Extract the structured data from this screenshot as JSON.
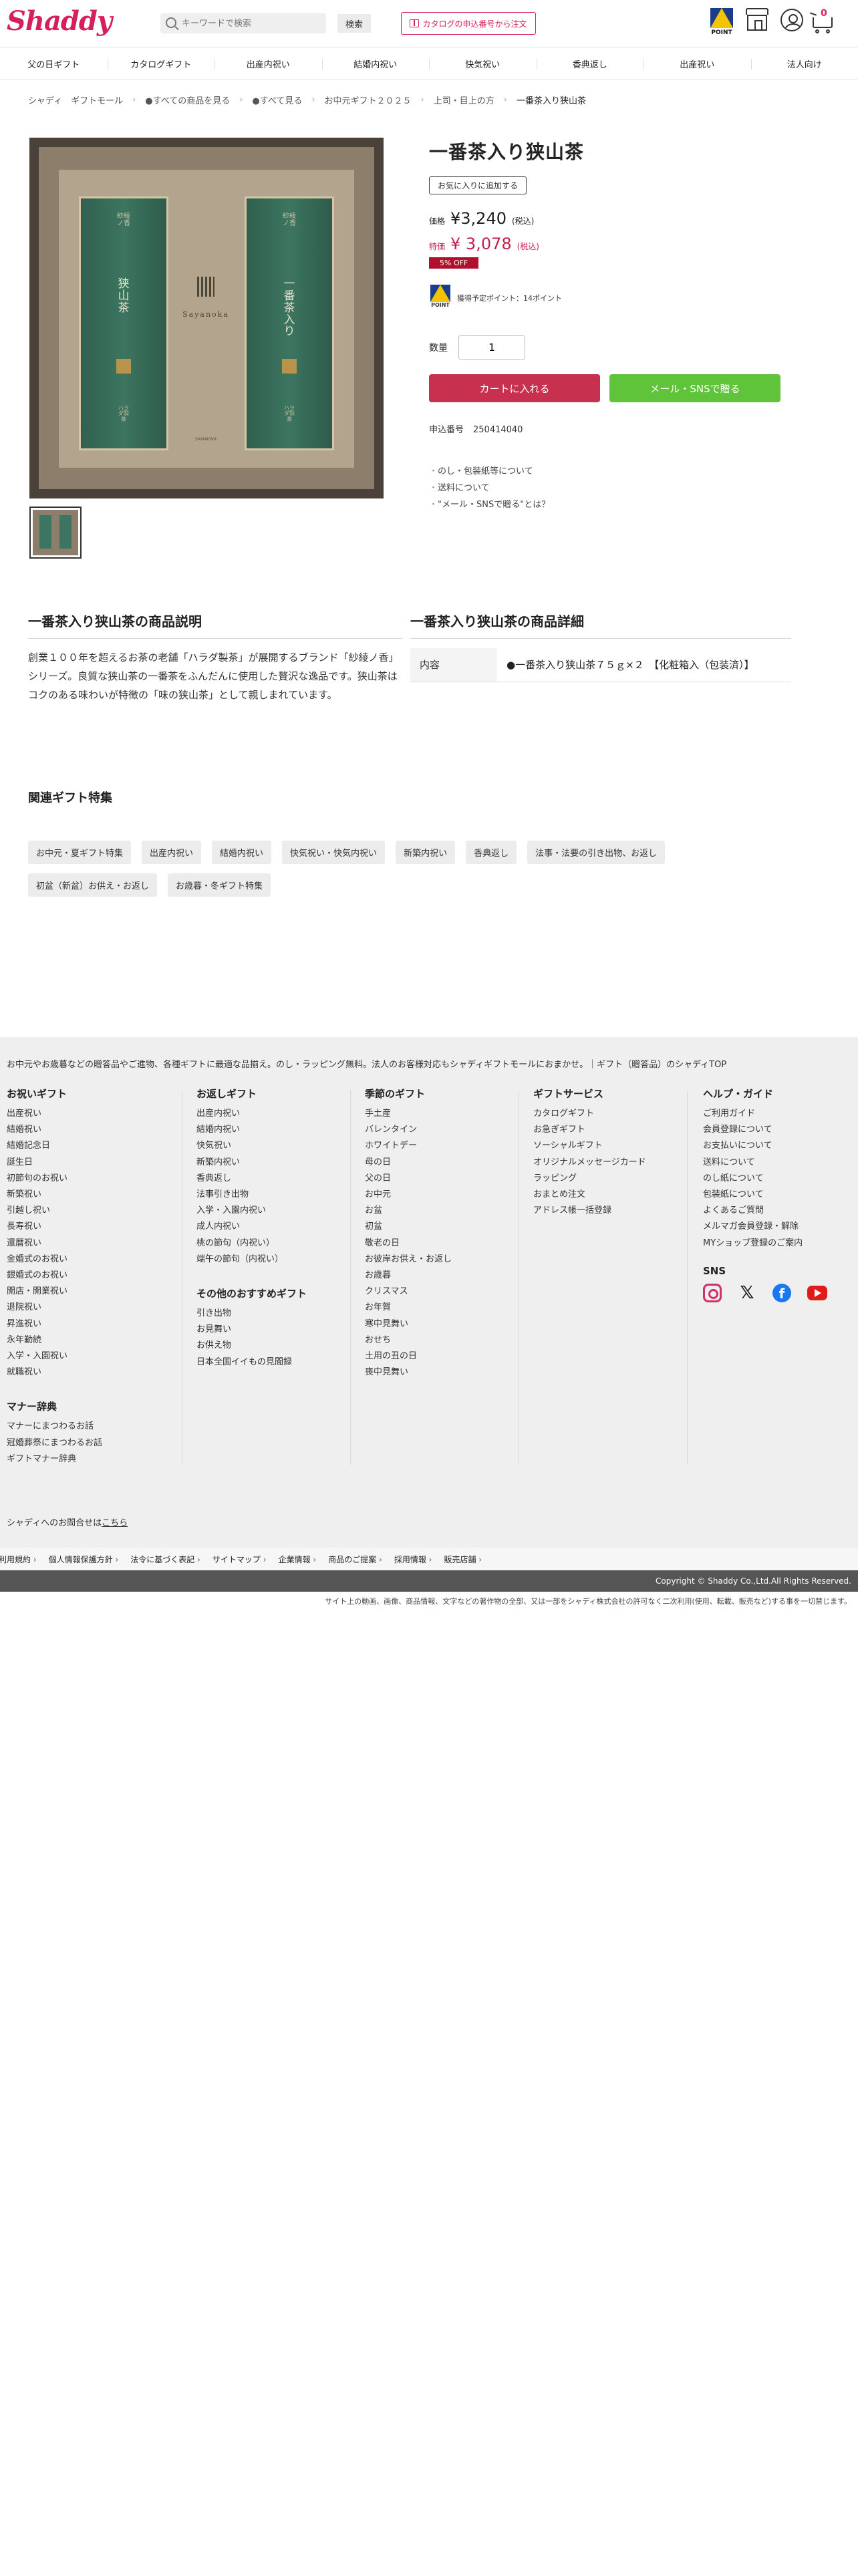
{
  "header": {
    "logo": "Shaddy",
    "search_placeholder": "キーワードで検索",
    "search_button": "検索",
    "catalog_button": "カタログの申込番号から注文",
    "point_label": "POINT",
    "cart_count": "0"
  },
  "nav": [
    "父の日ギフト",
    "カタログギフト",
    "出産内祝い",
    "結婚内祝い",
    "快気祝い",
    "香典返し",
    "出産祝い",
    "法人向け"
  ],
  "breadcrumb": [
    "シャディ　ギフトモール",
    "●すべての商品を見る",
    "●すべて見る",
    "お中元ギフト２０２５",
    "上司・目上の方",
    "一番茶入り狭山茶"
  ],
  "product": {
    "title": "一番茶入り狭山茶",
    "fav_button": "お気に入りに追加する",
    "price_label": "価格",
    "price": "¥3,240",
    "tax": "(税込)",
    "sale_label": "特価",
    "sale_price": "¥ 3,078",
    "sale_tax": "(税込)",
    "off_badge": "5% OFF",
    "point_note": "獲得予定ポイント：14ポイント",
    "qty_label": "数量",
    "qty_value": "1",
    "cart_button": "カートに入れる",
    "mail_button": "メール・SNSで贈る",
    "code_label": "申込番号",
    "code": "250414040",
    "links": [
      "のし・包装紙等について",
      "送料について",
      "\"メール・SNSで贈る\"とは？"
    ],
    "package_text": {
      "top": "紗綾ノ香",
      "name": "狭山茶",
      "sub": "一番茶入り",
      "brand": "Sayanoka",
      "fine_title": "SAYANOKA",
      "maker": "ハラダ製茶"
    }
  },
  "description": {
    "title": "一番茶入り狭山茶の商品説明",
    "text": "創業１００年を超えるお茶の老舗「ハラダ製茶」が展開するブランド「紗綾ノ香」シリーズ。良質な狭山茶の一番茶をふんだんに使用した贅沢な逸品です。狭山茶はコクのある味わいが特徴の「味の狭山茶」として親しまれています。"
  },
  "details": {
    "title": "一番茶入り狭山茶の商品詳細",
    "rows": [
      {
        "key": "内容",
        "value": "●一番茶入り狭山茶７５ｇ×２　【化粧箱入（包装済）】"
      }
    ]
  },
  "related": {
    "title": "関連ギフト特集",
    "tags": [
      "お中元・夏ギフト特集",
      "出産内祝い",
      "結婚内祝い",
      "快気祝い・快気内祝い",
      "新築内祝い",
      "香典返し",
      "法事・法要の引き出物、お返し",
      "初盆（新盆）お供え・お返し",
      "お歳暮・冬ギフト特集"
    ]
  },
  "footer": {
    "intro": "お中元やお歳暮などの贈答品やご進物、各種ギフトに最適な品揃え。のし・ラッピング無料。法人のお客様対応もシャディギフトモールにおまかせ。｜ギフト（贈答品）のシャディTOP",
    "col1": {
      "title": "お祝いギフト",
      "items": [
        "出産祝い",
        "結婚祝い",
        "結婚記念日",
        "誕生日",
        "初節句のお祝い",
        "新築祝い",
        "引越し祝い",
        "長寿祝い",
        "還暦祝い",
        "金婚式のお祝い",
        "銀婚式のお祝い",
        "開店・開業祝い",
        "退院祝い",
        "昇進祝い",
        "永年勤続",
        "入学・入園祝い",
        "就職祝い"
      ],
      "title2": "マナー辞典",
      "items2": [
        "マナーにまつわるお話",
        "冠婚葬祭にまつわるお話",
        "ギフトマナー辞典"
      ]
    },
    "col2": {
      "title": "お返しギフト",
      "items": [
        "出産内祝い",
        "結婚内祝い",
        "快気祝い",
        "新築内祝い",
        "香典返し",
        "法事引き出物",
        "入学・入園内祝い",
        "成人内祝い",
        "桃の節句（内祝い）",
        "端午の節句（内祝い）"
      ],
      "title2": "その他のおすすめギフト",
      "items2": [
        "引き出物",
        "お見舞い",
        "お供え物",
        "日本全国イイもの見聞録"
      ]
    },
    "col3": {
      "title": "季節のギフト",
      "items": [
        "手土産",
        "バレンタイン",
        "ホワイトデー",
        "母の日",
        "父の日",
        "お中元",
        "お盆",
        "初盆",
        "敬老の日",
        "お彼岸お供え・お返し",
        "お歳暮",
        "クリスマス",
        "お年賀",
        "寒中見舞い",
        "おせち",
        "土用の丑の日",
        "喪中見舞い"
      ]
    },
    "col4": {
      "title": "ギフトサービス",
      "items": [
        "カタログギフト",
        "お急ぎギフト",
        "ソーシャルギフト",
        "オリジナルメッセージカード",
        "ラッピング",
        "おまとめ注文",
        "アドレス帳一括登録"
      ]
    },
    "col5": {
      "title": "ヘルプ・ガイド",
      "items": [
        "ご利用ガイド",
        "会員登録について",
        "お支払いについて",
        "送料について",
        "のし紙について",
        "包装紙について",
        "よくあるご質問",
        "メルマガ会員登録・解除",
        "MYショップ登録のご案内"
      ],
      "sns_title": "SNS"
    },
    "contact_prefix": "シャディへのお問合せは",
    "contact_link": "こちら",
    "legal": [
      "ご利用規約",
      "個人情報保護方針",
      "法令に基づく表記",
      "サイトマップ",
      "企業情報",
      "商品のご提案",
      "採用情報",
      "販売店舗"
    ],
    "copyright": "Copyright © Shaddy Co.,Ltd.All Rights Reserved.",
    "rights_note": "サイト上の動画、画像、商品情報、文字などの著作物の全部、又は一部をシャディ株式会社の許可なく二次利用(使用、転載、販売など)する事を一切禁じます。"
  },
  "colors": {
    "brand": "#d61f5c",
    "sale": "#c41d4a",
    "cart_button": "#c8304f",
    "mail_button": "#5fc43a"
  }
}
